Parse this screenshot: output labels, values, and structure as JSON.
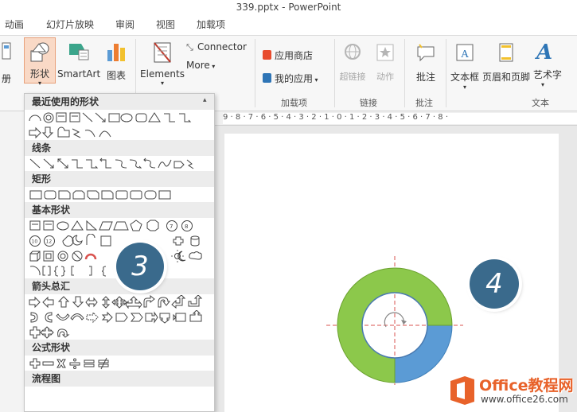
{
  "window": {
    "title": "339.pptx - PowerPoint"
  },
  "tabs": [
    "动画",
    "幻灯片放映",
    "审阅",
    "视图",
    "加载项"
  ],
  "ribbon": {
    "left_cut_label": "册",
    "shapes_label": "形状",
    "smartart_label": "SmartArt",
    "chart_label": "图表",
    "elements_label": "Elements",
    "connector_label": "Connector",
    "more_label": "More",
    "app_store_label": "应用商店",
    "my_apps_label": "我的应用",
    "addins_group": "加载项",
    "hyperlink_label": "超链接",
    "action_label": "动作",
    "links_group": "链接",
    "comment_label": "批注",
    "comment_group": "批注",
    "textbox_label": "文本框",
    "header_footer_label": "页眉和页脚",
    "wordart_label": "艺术字",
    "text_group": "文本"
  },
  "ruler": {
    "text": "9 · 8 · 7 · 6 · 5 · 4 · 3 · 2 · 1 · 0 · 1 · 2 · 3 · 4 · 5 · 6 · 7 · 8 ·"
  },
  "shapes_panel": {
    "sections": [
      "最近使用的形状",
      "线条",
      "矩形",
      "基本形状",
      "箭头总汇",
      "公式形状",
      "流程图"
    ]
  },
  "badges": {
    "step3": "3",
    "step4": "4"
  },
  "colors": {
    "accent_green": "#8cc84b",
    "accent_blue": "#5b9bd5",
    "badge": "#3a6a8c",
    "brand_orange": "#e8622a"
  },
  "watermark": {
    "brand": "Office教程网",
    "url": "www.office26.com"
  }
}
